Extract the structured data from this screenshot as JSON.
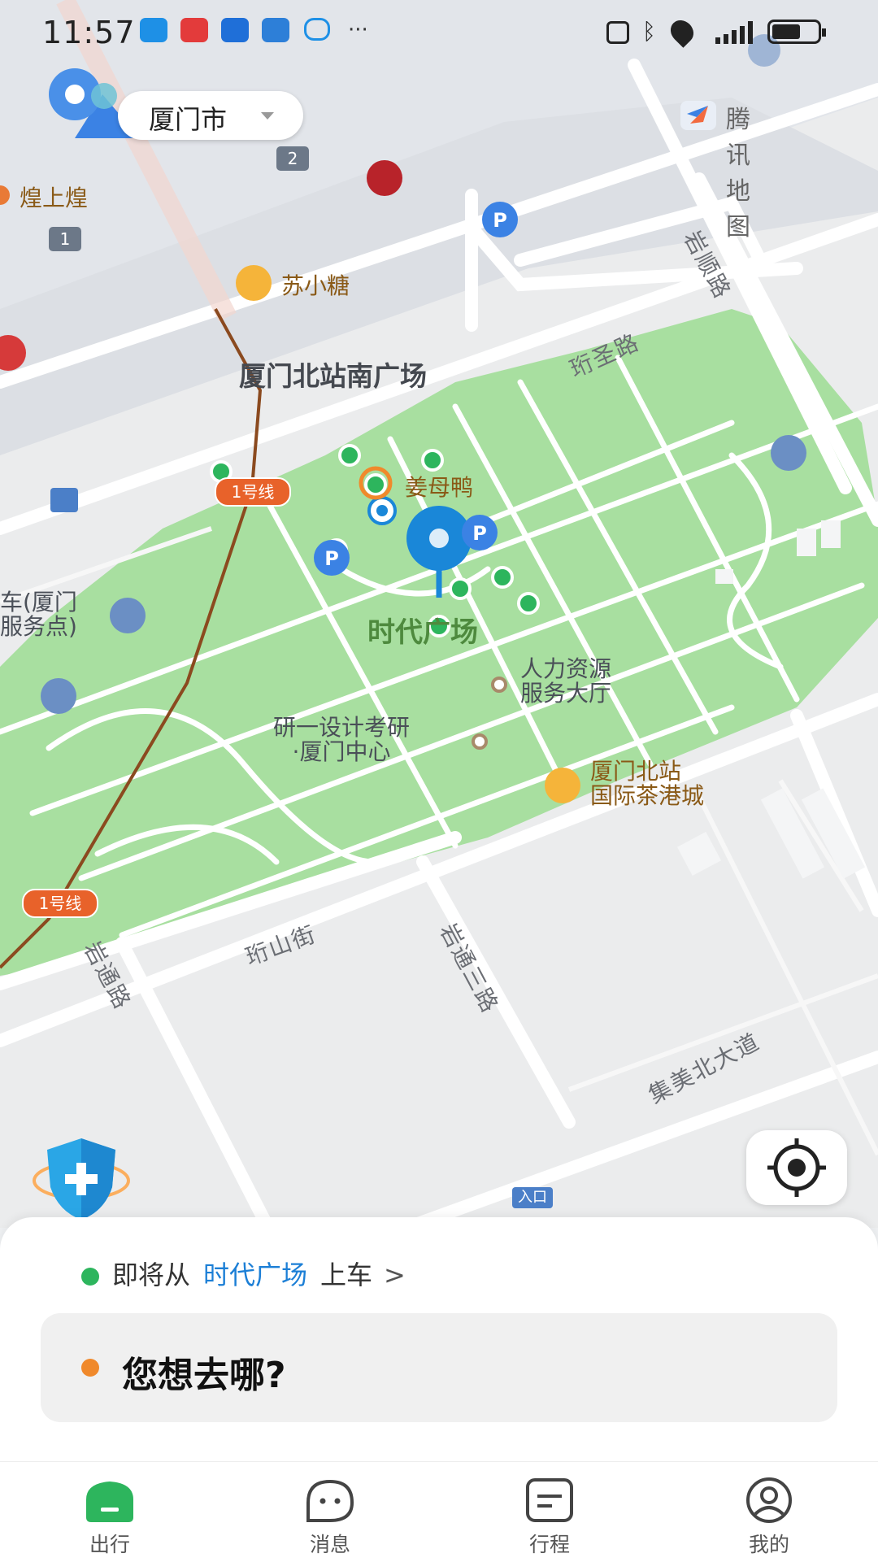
{
  "status_bar": {
    "time": "11:57",
    "overflow": "···"
  },
  "header": {
    "city": "厦门市",
    "map_provider": "腾讯地图"
  },
  "map": {
    "area_title": "厦门北站南广场",
    "selected_place": "时代广场",
    "pois": {
      "huang_shang_huang": "煌上煌",
      "su_xiao_tang": "苏小糖",
      "jiang_mu_ya": "姜母鸭",
      "hr_hall_line1": "人力资源",
      "hr_hall_line2": "服务大厅",
      "yanyi_line1": "研一设计考研",
      "yanyi_line2": "·厦门中心",
      "tea_city_line1": "厦门北站",
      "tea_city_line2": "国际茶港城",
      "car_service_line1": "车(厦门",
      "car_service_line2": "服务点)"
    },
    "roads": {
      "yanshun": "岩顺路",
      "hengsheng": "珩圣路",
      "hengshan": "珩山街",
      "yantong": "岩通路",
      "yantong3": "岩通三路",
      "jimei_north": "集美北大道"
    },
    "metro_label": "1号线",
    "parking_label": "P",
    "exit_badges": [
      "1",
      "2"
    ],
    "entrance_label": "入口"
  },
  "trip": {
    "pickup_prefix": "即将从",
    "pickup_place": "时代广场",
    "pickup_suffix": "上车",
    "pickup_chevron": ">",
    "destination_placeholder": "您想去哪?"
  },
  "tabs": [
    {
      "label": "出行",
      "icon": "car-icon",
      "active": true
    },
    {
      "label": "消息",
      "icon": "message-icon",
      "active": false
    },
    {
      "label": "行程",
      "icon": "itinerary-icon",
      "active": false
    },
    {
      "label": "我的",
      "icon": "profile-icon",
      "active": false
    }
  ],
  "colors": {
    "accent_green": "#2db55d",
    "link_blue": "#1c7fd6",
    "pin_blue": "#1a87d8",
    "dest_orange": "#f0892b",
    "park_green": "#a8dfa0",
    "metro_line": "#8b4a1f"
  }
}
